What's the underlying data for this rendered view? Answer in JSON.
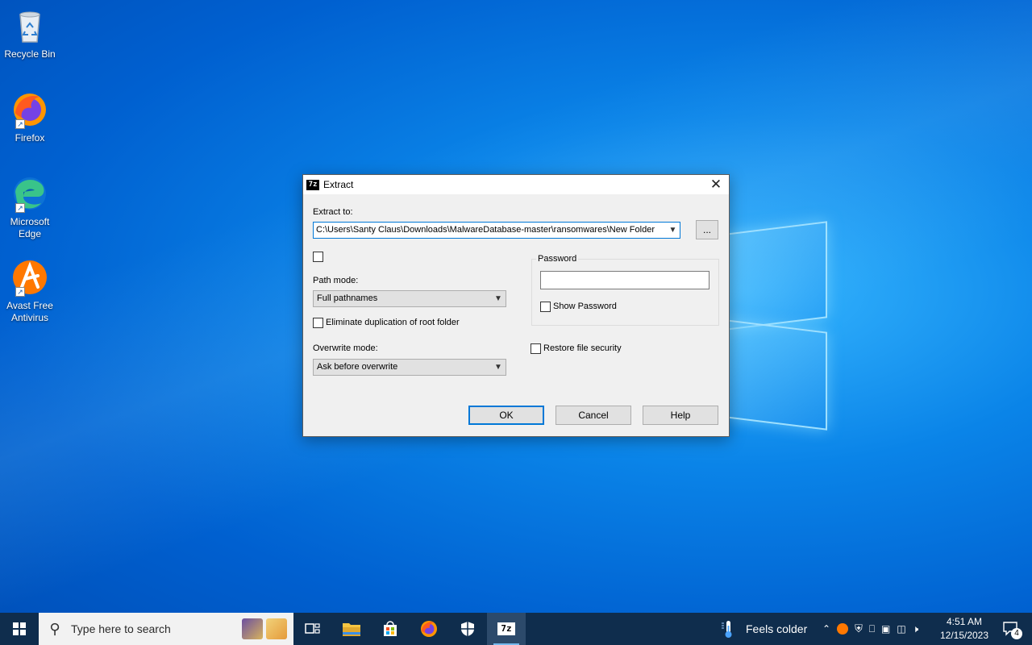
{
  "desktop": {
    "icons": [
      {
        "label": "Recycle Bin",
        "icon": "recycle-bin-icon"
      },
      {
        "label": "Firefox",
        "icon": "firefox-icon"
      },
      {
        "label": "Microsoft Edge",
        "icon": "edge-icon"
      },
      {
        "label": "Avast Free Antivirus",
        "icon": "avast-icon"
      }
    ]
  },
  "dialog": {
    "app_icon_text": "7z",
    "title": "Extract",
    "close_glyph": "✕",
    "extract_to_label": "Extract to:",
    "extract_path": "C:\\Users\\Santy Claus\\Downloads\\MalwareDatabase-master\\ransomwares\\New Folder",
    "browse_label": "...",
    "path_mode_label": "Path mode:",
    "path_mode_value": "Full pathnames",
    "eliminate_dup_label": "Eliminate duplication of root folder",
    "overwrite_mode_label": "Overwrite mode:",
    "overwrite_mode_value": "Ask before overwrite",
    "password_group_label": "Password",
    "password_value": "",
    "show_password_label": "Show Password",
    "restore_security_label": "Restore file security",
    "ok_label": "OK",
    "cancel_label": "Cancel",
    "help_label": "Help"
  },
  "taskbar": {
    "search_placeholder": "Type here to search",
    "apps": [
      "task-view",
      "file-explorer",
      "microsoft-store",
      "firefox",
      "windows-security",
      "7-zip"
    ],
    "weather_text": "Feels colder",
    "time": "4:51 AM",
    "date": "12/15/2023",
    "notification_count": "4"
  },
  "colors": {
    "desktop_blue": "#0a84e8",
    "accent": "#0078d7",
    "taskbar": "#0f2d4d"
  }
}
